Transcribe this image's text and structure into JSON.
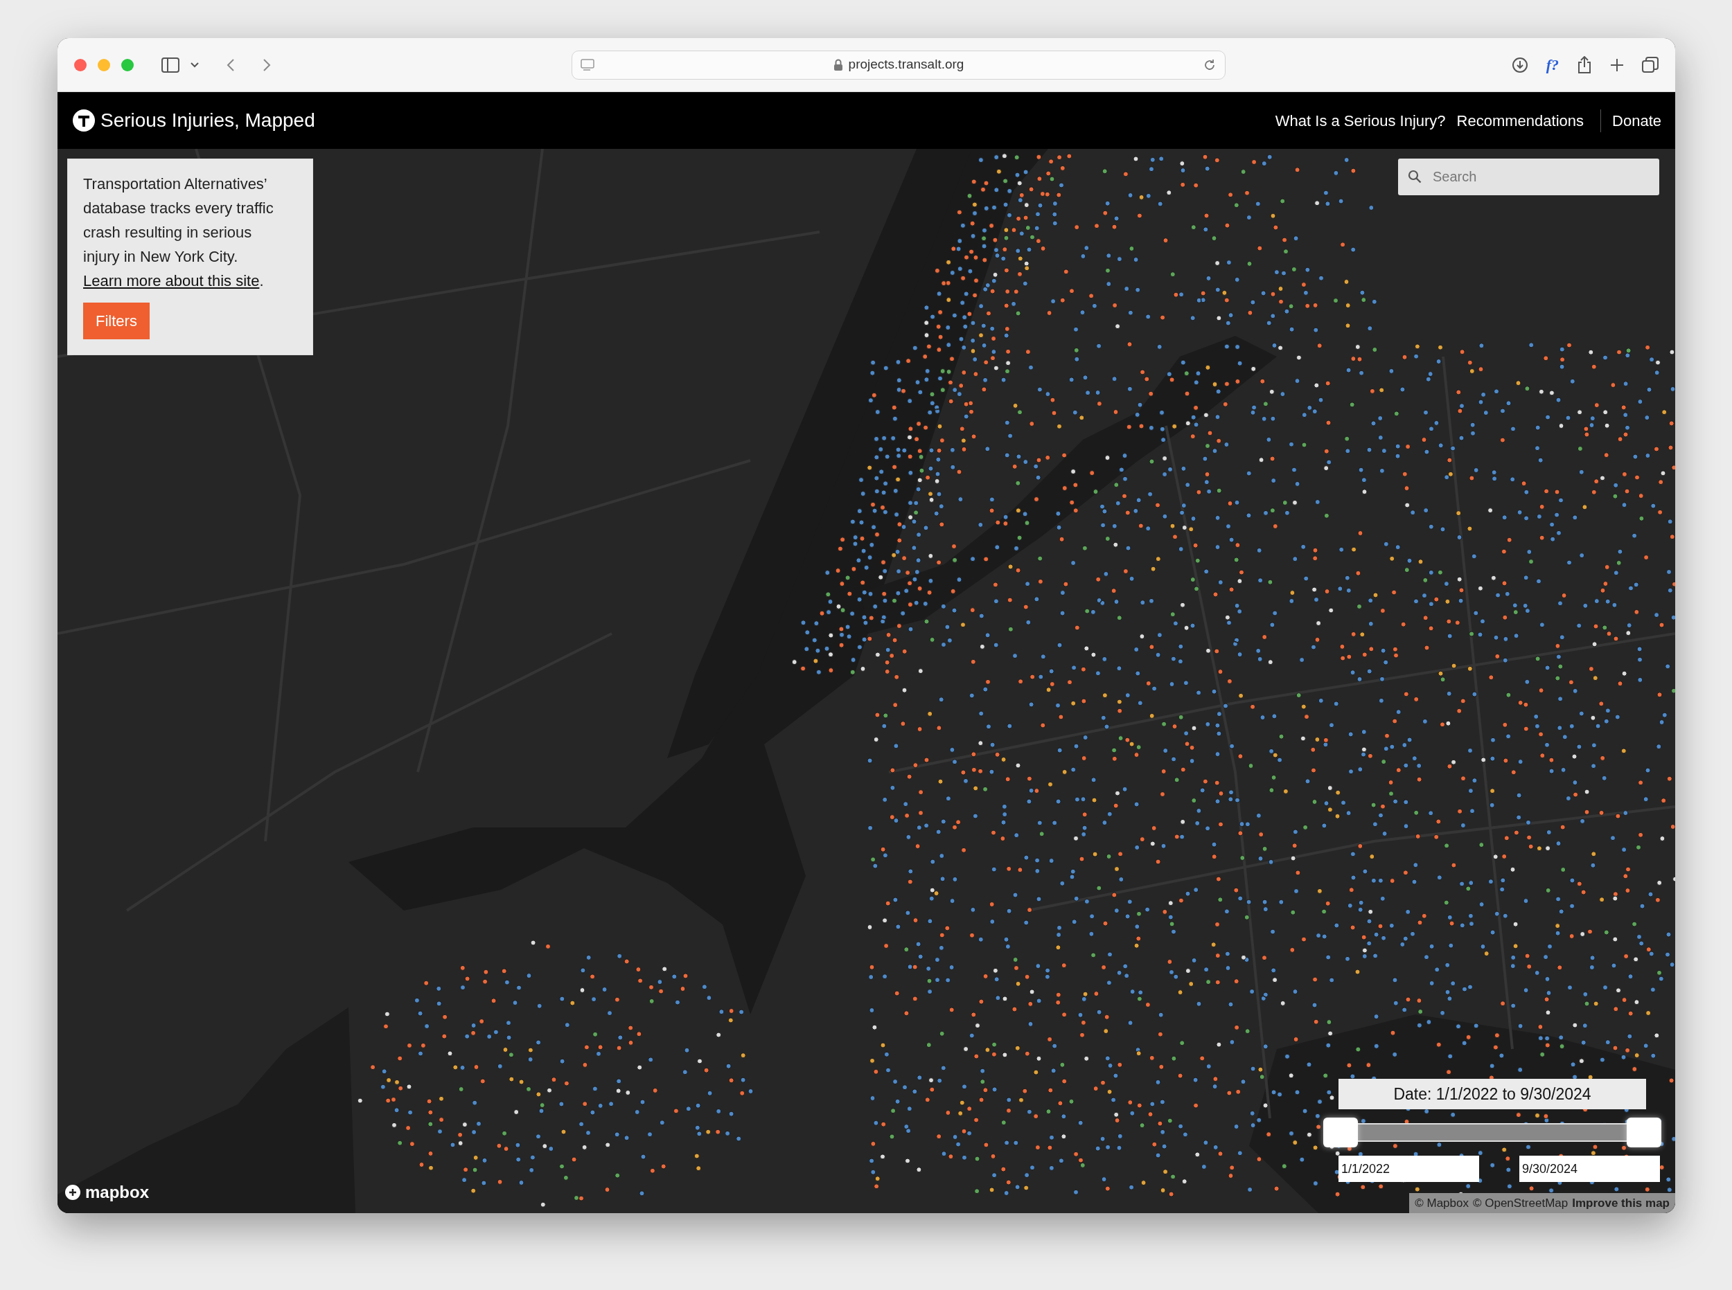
{
  "browser": {
    "url": "projects.transalt.org",
    "extension_label": "f?"
  },
  "navbar": {
    "title": "Serious Injuries, Mapped",
    "links": [
      {
        "label": "What Is a Serious Injury?",
        "divider_before": false
      },
      {
        "label": "Recommendations",
        "divider_before": false
      },
      {
        "label": "Donate",
        "divider_before": true
      }
    ]
  },
  "info_panel": {
    "text": "Transportation Alternatives’ database tracks every traffic crash resulting in serious injury in New York City. ",
    "link": "Learn more about this site",
    "after_link": ".",
    "button": "Filters"
  },
  "search": {
    "placeholder": "Search"
  },
  "date_filter": {
    "label": "Date: 1/1/2022 to 9/30/2024",
    "handles": [
      {
        "level": 0
      },
      {
        "level": 1
      }
    ],
    "start": "1/1/2022",
    "end": "9/30/2024"
  },
  "map": {
    "kind": "picture",
    "logo": "mapbox",
    "attribution": [
      {
        "text": "© Mapbox",
        "bold": false
      },
      {
        "text": "© OpenStreetMap",
        "bold": false
      },
      {
        "text": "Improve this map",
        "bold": true
      }
    ]
  }
}
